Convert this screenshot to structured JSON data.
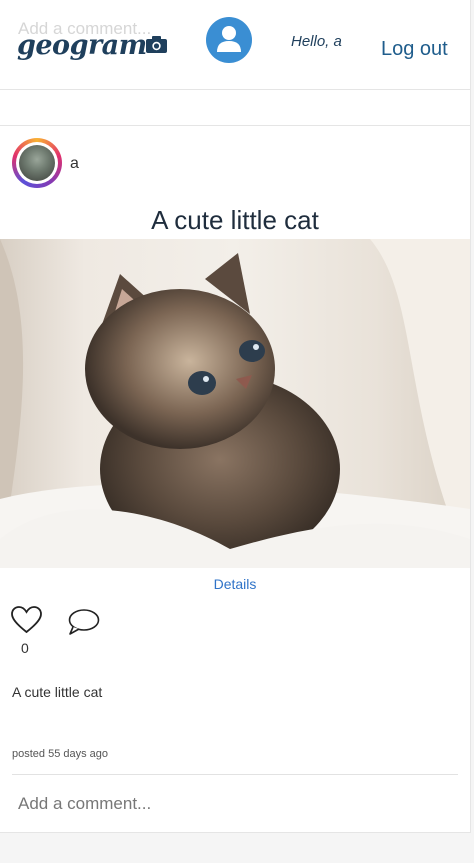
{
  "header": {
    "ghost_comment_placeholder": "Add a comment...",
    "logo": "geogram",
    "camera_icon": "camera-icon",
    "avatar_icon": "user-icon",
    "greeting": "Hello, a",
    "logout_label": "Log out"
  },
  "post": {
    "username": "a",
    "title": "A cute little cat",
    "image_subject": "cat",
    "details_label": "Details",
    "likes": "0",
    "caption": "A cute little cat",
    "posted": "posted 55 days ago",
    "comment_placeholder": "Add a comment..."
  },
  "colors": {
    "brand": "#1f3f5c",
    "avatar_bg": "#3a8ed3",
    "link": "#2f73c8"
  }
}
